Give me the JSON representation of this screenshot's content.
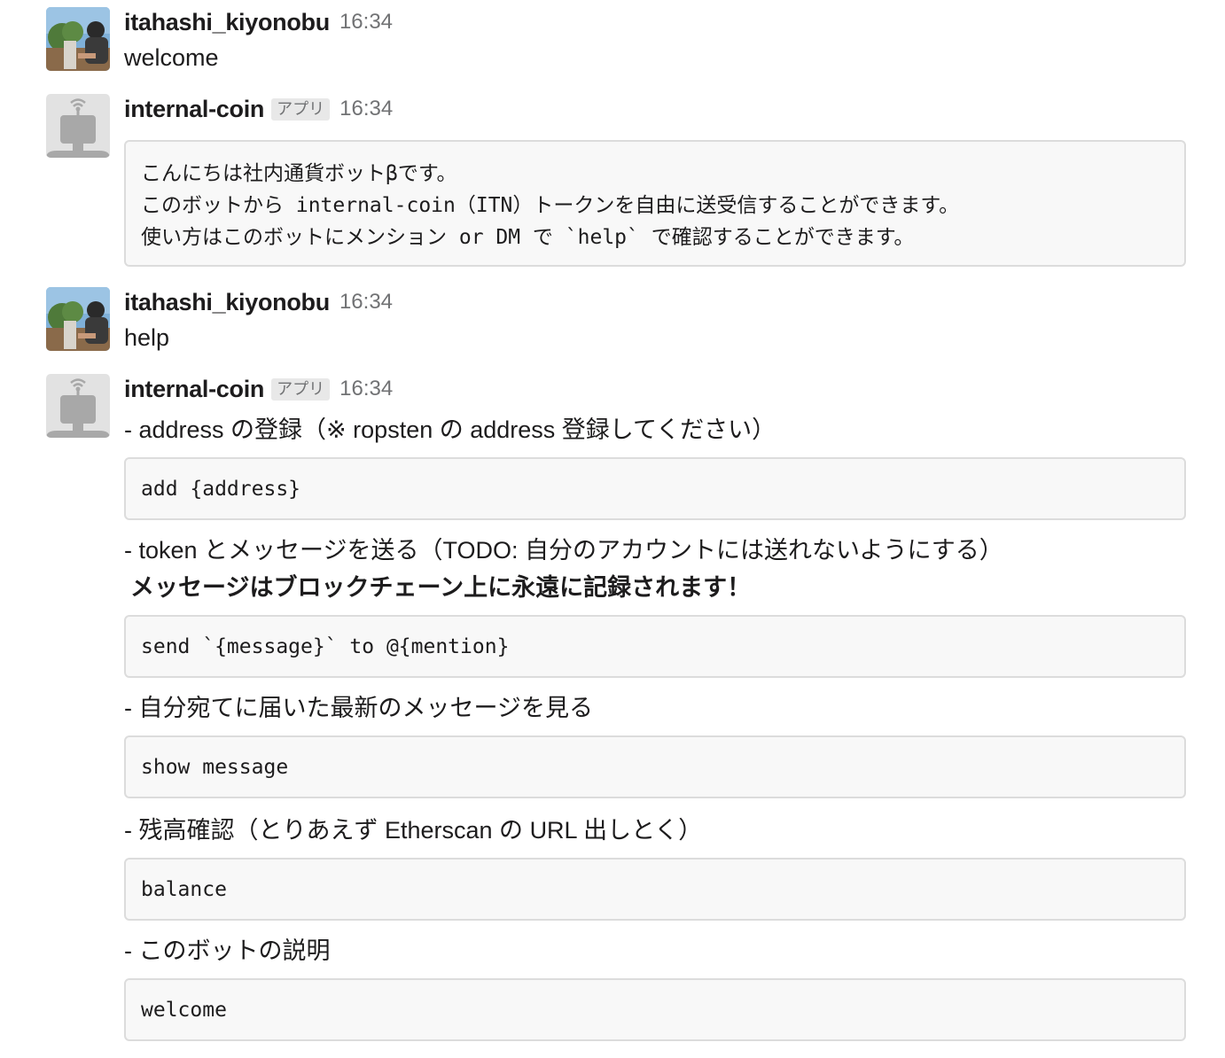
{
  "messages": [
    {
      "user": "itahashi_kiyonobu",
      "time": "16:34",
      "text": "welcome"
    },
    {
      "user": "internal-coin",
      "badge": "アプリ",
      "time": "16:34",
      "code_lines": [
        "こんにちは社内通貨ボットβです。",
        "このボットから internal-coin（ITN）トークンを自由に送受信することができます。",
        "使い方はこのボットにメンション or DM で `help` で確認することができます。"
      ]
    },
    {
      "user": "itahashi_kiyonobu",
      "time": "16:34",
      "text": "help"
    },
    {
      "user": "internal-coin",
      "badge": "アプリ",
      "time": "16:34",
      "help": {
        "add_desc": "- address の登録（※ ropsten の address 登録してください）",
        "add_cmd": "add {address}",
        "send_desc": "- token とメッセージを送る（TODO: 自分のアカウントには送れないようにする）",
        "send_warning": "メッセージはブロックチェーン上に永遠に記録されます！",
        "send_cmd": "send `{message}` to @{mention}",
        "show_desc": "- 自分宛てに届いた最新のメッセージを見る",
        "show_cmd": "show message",
        "balance_desc": "- 残高確認（とりあえず Etherscan の URL 出しとく）",
        "balance_cmd": "balance",
        "welcome_desc": "- このボットの説明",
        "welcome_cmd": "welcome"
      }
    }
  ],
  "colors": {
    "code_bg": "#f8f8f8",
    "code_border": "#dcdcdc",
    "timestamp": "#717274",
    "badge_bg": "#e8e8e8"
  },
  "icons": {
    "user_avatar": "user-photo-avatar",
    "bot_avatar": "robot-antenna-avatar"
  }
}
